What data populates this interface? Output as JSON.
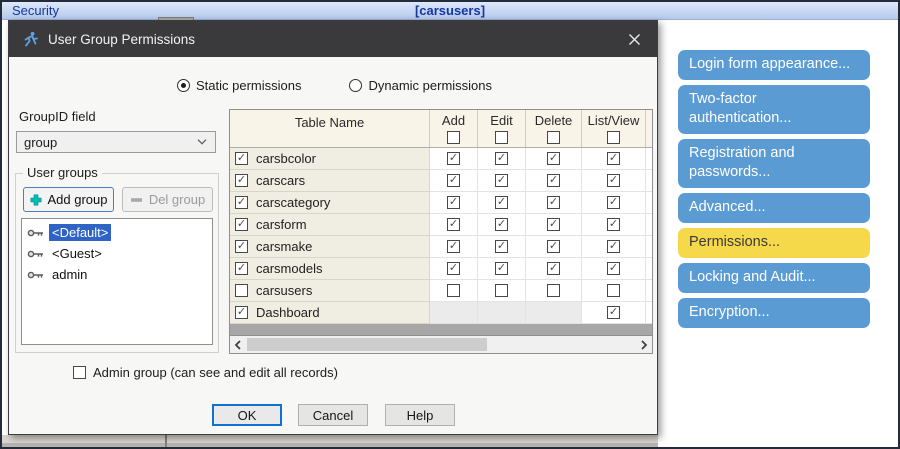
{
  "window": {
    "left_title": "Security",
    "center_title": "[carsusers]"
  },
  "dialog": {
    "title": "User Group Permissions",
    "title_icon": "running-person-icon",
    "close_icon": "close-icon",
    "permission_mode": {
      "options": [
        {
          "label": "Static permissions",
          "selected": true
        },
        {
          "label": "Dynamic permissions",
          "selected": false
        }
      ]
    },
    "groupid": {
      "label": "GroupID field",
      "value": "group",
      "icon": "chevron-down-icon"
    },
    "user_groups": {
      "title": "User groups",
      "add_button": "Add group",
      "add_icon": "plus-icon",
      "del_button": "Del group",
      "del_icon": "minus-icon",
      "del_enabled": false,
      "item_icon": "key-icon",
      "items": [
        {
          "label": "<Default>",
          "selected": true
        },
        {
          "label": "<Guest>",
          "selected": false
        },
        {
          "label": "admin",
          "selected": false
        }
      ]
    },
    "table": {
      "name_header": "Table Name",
      "perm_headers": [
        "Add",
        "Edit",
        "Delete",
        "List/View"
      ],
      "header_checkboxes": [
        false,
        false,
        false,
        false
      ],
      "rows": [
        {
          "name": "carsbcolor",
          "name_checked": true,
          "perms": [
            true,
            true,
            true,
            true
          ]
        },
        {
          "name": "carscars",
          "name_checked": true,
          "perms": [
            true,
            true,
            true,
            true
          ]
        },
        {
          "name": "carscategory",
          "name_checked": true,
          "perms": [
            true,
            true,
            true,
            true
          ]
        },
        {
          "name": "carsform",
          "name_checked": true,
          "perms": [
            true,
            true,
            true,
            true
          ]
        },
        {
          "name": "carsmake",
          "name_checked": true,
          "perms": [
            true,
            true,
            true,
            true
          ]
        },
        {
          "name": "carsmodels",
          "name_checked": true,
          "perms": [
            true,
            true,
            true,
            true
          ]
        },
        {
          "name": "carsusers",
          "name_checked": false,
          "perms": [
            false,
            false,
            false,
            false
          ]
        },
        {
          "name": "Dashboard",
          "name_checked": true,
          "perms": [
            null,
            null,
            null,
            true
          ]
        }
      ],
      "scrollbar": {
        "left_icon": "chevron-left-icon",
        "right_icon": "chevron-right-icon"
      }
    },
    "admin_checkbox": {
      "label": "Admin group (can see and edit all records)",
      "checked": false
    },
    "action_buttons": [
      {
        "label": "OK",
        "default": true
      },
      {
        "label": "Cancel",
        "default": false
      },
      {
        "label": "Help",
        "default": false
      }
    ]
  },
  "side_panel": {
    "buttons": [
      {
        "label": "Login form appearance...",
        "highlight": false
      },
      {
        "label": "Two-factor authentication...",
        "highlight": false
      },
      {
        "label": "Registration and passwords...",
        "highlight": false
      },
      {
        "label": "Advanced...",
        "highlight": false
      },
      {
        "label": "Permissions...",
        "highlight": true
      },
      {
        "label": "Locking and Audit...",
        "highlight": false
      },
      {
        "label": "Encryption...",
        "highlight": false
      }
    ]
  },
  "colors": {
    "accent_blue": "#5b9bd4",
    "highlight_yellow": "#f5d94a",
    "selection_blue": "#2f63c5",
    "titlebar_dark": "#3a3a3d",
    "table_header_bg": "#f8f4e8",
    "table_name_bg": "#f0ede2"
  }
}
